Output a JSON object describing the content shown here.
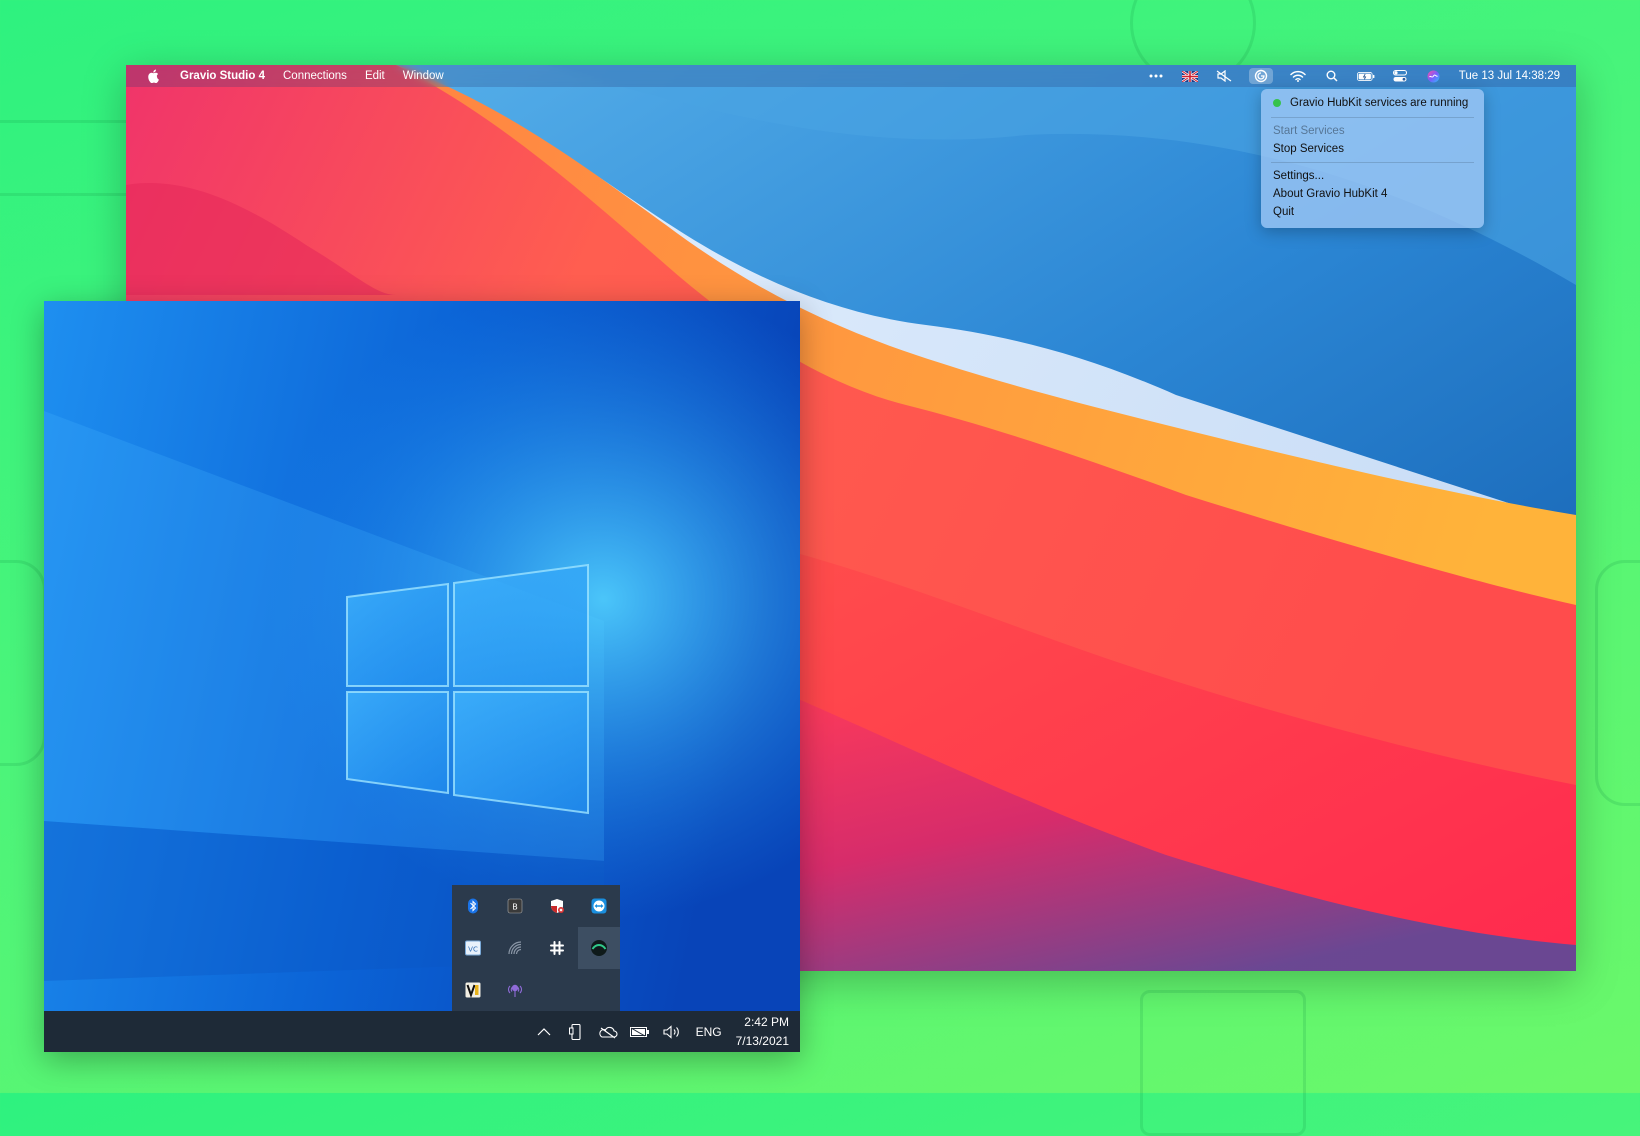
{
  "mac": {
    "menubar": {
      "app_name": "Gravio Studio 4",
      "menus": [
        "Connections",
        "Edit",
        "Window"
      ],
      "clock": "Tue 13 Jul  14:38:29",
      "status_icons": [
        "ellipsis-icon",
        "uk-flag-icon",
        "mute-icon",
        "gravio-hubkit-icon",
        "wifi-icon",
        "spotlight-search-icon",
        "battery-icon",
        "control-center-icon",
        "siri-icon"
      ]
    },
    "dropdown": {
      "status_text": "Gravio HubKit services are running",
      "status_color": "#36c24a",
      "items": [
        {
          "label": "Start Services",
          "enabled": false
        },
        {
          "label": "Stop Services",
          "enabled": true
        },
        {
          "label": "Settings...",
          "enabled": true
        },
        {
          "label": "About Gravio HubKit 4",
          "enabled": true
        },
        {
          "label": "Quit",
          "enabled": true
        }
      ]
    }
  },
  "windows": {
    "tray_overflow_icons": [
      "bluetooth-icon",
      "app-icon",
      "security-shield-icon",
      "teamviewer-icon",
      "vc-app-icon",
      "wireless-icon",
      "slack-icon",
      "gravio-hubkit-icon",
      "media-app-icon",
      "network-app-icon"
    ],
    "taskbar": {
      "icons": [
        "show-hidden-icons-icon",
        "device-icon",
        "onedrive-icon",
        "battery-icon",
        "volume-icon"
      ],
      "language": "ENG",
      "time": "2:42 PM",
      "date": "7/13/2021"
    }
  }
}
